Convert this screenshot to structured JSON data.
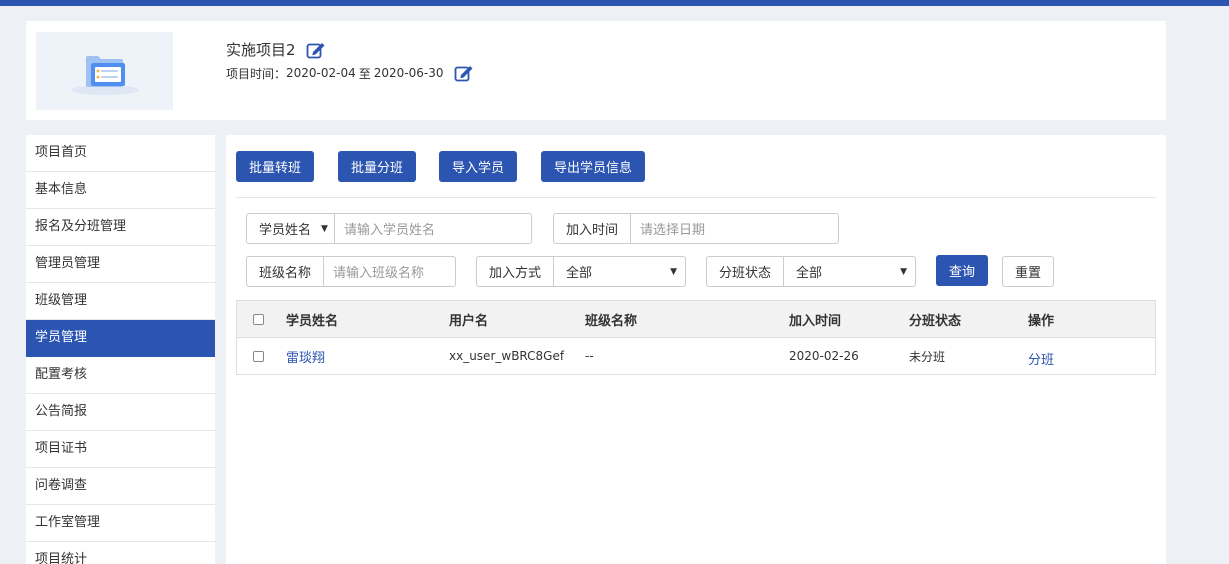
{
  "header": {
    "project_title": "实施项目2",
    "time_label": "项目时间：",
    "start_date": "2020-02-04",
    "range_sep": "至",
    "end_date": "2020-06-30"
  },
  "sidebar": {
    "items": [
      {
        "label": "项目首页"
      },
      {
        "label": "基本信息"
      },
      {
        "label": "报名及分班管理"
      },
      {
        "label": "管理员管理"
      },
      {
        "label": "班级管理"
      },
      {
        "label": "学员管理",
        "active": true
      },
      {
        "label": "配置考核"
      },
      {
        "label": "公告简报"
      },
      {
        "label": "项目证书"
      },
      {
        "label": "问卷调查"
      },
      {
        "label": "工作室管理"
      },
      {
        "label": "项目统计"
      }
    ]
  },
  "toolbar": {
    "batch_transfer": "批量转班",
    "batch_assign": "批量分班",
    "import_students": "导入学员",
    "export_students": "导出学员信息"
  },
  "filters": {
    "name_select": "学员姓名",
    "name_placeholder": "请输入学员姓名",
    "join_time_label": "加入时间",
    "join_time_placeholder": "请选择日期",
    "class_name_label": "班级名称",
    "class_name_placeholder": "请输入班级名称",
    "join_method_label": "加入方式",
    "join_method_value": "全部",
    "class_status_label": "分班状态",
    "class_status_value": "全部",
    "query_label": "查询",
    "reset_label": "重置"
  },
  "table": {
    "headers": {
      "name": "学员姓名",
      "username": "用户名",
      "class_name": "班级名称",
      "join_time": "加入时间",
      "status": "分班状态",
      "action": "操作"
    },
    "rows": [
      {
        "name": "雷琰翔",
        "username": "xx_user_wBRC8Gef",
        "class_name": "--",
        "join_time": "2020-02-26",
        "status": "未分班",
        "action": "分班"
      }
    ]
  },
  "colors": {
    "primary": "#2b55b0",
    "background": "#edf0f4"
  }
}
